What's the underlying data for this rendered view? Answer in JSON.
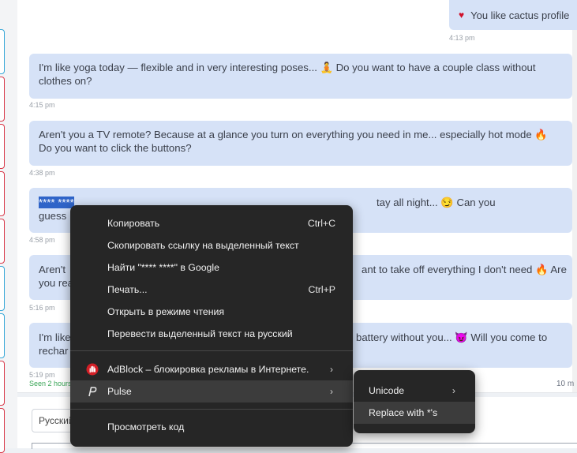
{
  "chat": {
    "outgoing": {
      "icon": "heart-icon",
      "text": "You like cactus profile",
      "time": "4:13 pm"
    },
    "messages": [
      {
        "text": "I'm like yoga today — flexible and in very interesting poses... 🧘 Do you want to have a couple class without clothes on?",
        "time": "4:15 pm"
      },
      {
        "text": "Aren't you a TV remote? Because at a glance you turn on everything you need in me... especially hot mode 🔥 Do you want to click the buttons?",
        "time": "4:38 pm"
      },
      {
        "selected": "**** ****",
        "text_visible": "guess",
        "text_right": "tay all night... 😏 Can you",
        "time": "4:58 pm"
      },
      {
        "text_left": "Aren't",
        "text_left2": "you rea",
        "text_right": "ant to take off everything I don't need 🔥 Are",
        "time": "5:16 pm"
      },
      {
        "text_left": "I'm like",
        "text_left2": "rechar",
        "text_right": "battery without you... 😈 Will you come to",
        "time": "5:19 pm"
      }
    ],
    "seen": "Seen 2 hours",
    "right_meta": "10 m"
  },
  "bottom": {
    "language": "Русский"
  },
  "context_menu": {
    "items": [
      {
        "label": "Копировать",
        "shortcut": "Ctrl+C"
      },
      {
        "label": "Скопировать ссылку на выделенный текст"
      },
      {
        "label": "Найти \"**** ****\" в Google"
      },
      {
        "label": "Печать...",
        "shortcut": "Ctrl+P"
      },
      {
        "label": "Открыть в режиме чтения"
      },
      {
        "label": "Перевести выделенный текст на русский"
      },
      {
        "label": "AdBlock – блокировка рекламы в Интернете.",
        "icon": "adblock-hand-icon"
      },
      {
        "label": "Pulse",
        "icon": "pulse-p-icon"
      },
      {
        "label": "Просмотреть код"
      }
    ],
    "submenu": [
      {
        "label": "Unicode"
      },
      {
        "label": "Replace with *'s"
      }
    ]
  },
  "colors": {
    "bubble": "#d6e2f7",
    "selection": "#2f64c8",
    "menu": "#262626",
    "seen": "#3aa657"
  }
}
